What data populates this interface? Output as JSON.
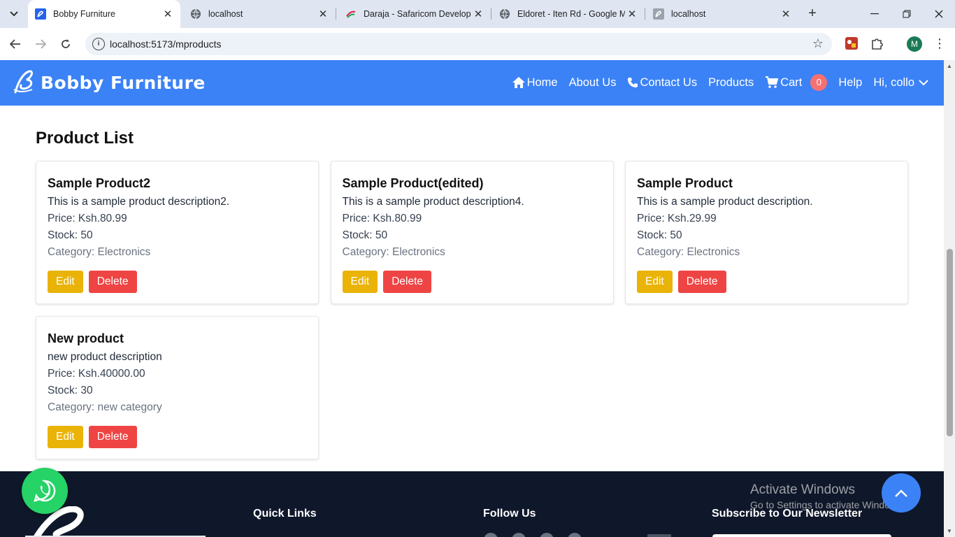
{
  "browser": {
    "tabs": [
      {
        "title": "Bobby Furniture",
        "active": true
      },
      {
        "title": "localhost",
        "active": false
      },
      {
        "title": "Daraja - Safaricom Develope",
        "active": false
      },
      {
        "title": "Eldoret - Iten Rd - Google M",
        "active": false
      },
      {
        "title": "localhost",
        "active": false
      }
    ],
    "new_tab": "+",
    "url": "localhost:5173/mproducts",
    "profile_initial": "M"
  },
  "nav": {
    "brand": "Bobby Furniture",
    "home": "Home",
    "about": "About Us",
    "contact": "Contact Us",
    "products": "Products",
    "cart": "Cart",
    "cart_count": "0",
    "help": "Help",
    "user": "Hi, collo"
  },
  "page": {
    "title": "Product List"
  },
  "products": [
    {
      "name": "Sample Product2",
      "description": "This is a sample product description2.",
      "price": "Price: Ksh.80.99",
      "stock": "Stock: 50",
      "category": "Category: Electronics",
      "edit": "Edit",
      "delete": "Delete"
    },
    {
      "name": "Sample Product(edited)",
      "description": "This is a sample product description4.",
      "price": "Price: Ksh.80.99",
      "stock": "Stock: 50",
      "category": "Category: Electronics",
      "edit": "Edit",
      "delete": "Delete"
    },
    {
      "name": "Sample Product",
      "description": "This is a sample product description.",
      "price": "Price: Ksh.29.99",
      "stock": "Stock: 50",
      "category": "Category: Electronics",
      "edit": "Edit",
      "delete": "Delete"
    },
    {
      "name": "New product",
      "description": "new product description",
      "price": "Price: Ksh.40000.00",
      "stock": "Stock: 30",
      "category": "Category: new category",
      "edit": "Edit",
      "delete": "Delete"
    }
  ],
  "footer": {
    "quick_links": "Quick Links",
    "follow_us": "Follow Us",
    "newsletter": "Subscribe to Our Newsletter"
  },
  "watermark": {
    "line1": "Activate Windows",
    "line2": "Go to Settings to activate Windows."
  },
  "colors": {
    "navbar": "#3b82f6",
    "edit": "#eab308",
    "delete": "#ef4444",
    "footer": "#0f172a",
    "whatsapp": "#25d366"
  }
}
